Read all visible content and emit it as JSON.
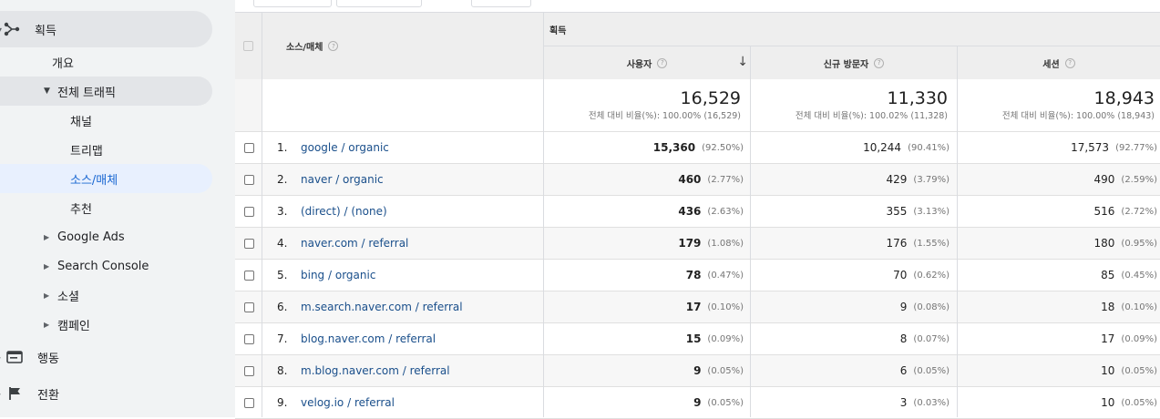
{
  "sidebar": {
    "sections": [
      {
        "label": "획득",
        "icon": "acquisition-icon"
      },
      {
        "label": "행동",
        "icon": "behavior-icon"
      },
      {
        "label": "전환",
        "icon": "flag-icon"
      }
    ],
    "items": [
      {
        "label": "개요"
      },
      {
        "label": "전체 트래픽"
      },
      {
        "label": "채널"
      },
      {
        "label": "트리맵"
      },
      {
        "label": "소스/매체"
      },
      {
        "label": "추천"
      },
      {
        "label": "Google Ads"
      },
      {
        "label": "Search Console"
      },
      {
        "label": "소셜"
      },
      {
        "label": "캠페인"
      }
    ],
    "colors": {
      "selected_bg": "#e8f0fe",
      "selected_text": "#1967d2",
      "group_bg": "#e3e5e8"
    }
  },
  "table": {
    "group_header": "획득",
    "dimension_header": "소스/매체",
    "help_glyph": "?",
    "sort_glyph": "↓",
    "columns": [
      {
        "label": "사용자"
      },
      {
        "label": "신규 방문자"
      },
      {
        "label": "세션"
      }
    ],
    "totals": [
      {
        "value": "16,529",
        "sub": "전체 대비 비율(%): 100.00% (16,529)"
      },
      {
        "value": "11,330",
        "sub": "전체 대비 비율(%): 100.02% (11,328)"
      },
      {
        "value": "18,943",
        "sub": "전체 대비 비율(%): 100.00% (18,943)"
      }
    ],
    "rows": [
      {
        "rank": "1.",
        "source": "google / organic",
        "users": "15,360",
        "users_pct": "(92.50%)",
        "new": "10,244",
        "new_pct": "(90.41%)",
        "sessions": "17,573",
        "sessions_pct": "(92.77%)"
      },
      {
        "rank": "2.",
        "source": "naver / organic",
        "users": "460",
        "users_pct": "(2.77%)",
        "new": "429",
        "new_pct": "(3.79%)",
        "sessions": "490",
        "sessions_pct": "(2.59%)"
      },
      {
        "rank": "3.",
        "source": "(direct) / (none)",
        "users": "436",
        "users_pct": "(2.63%)",
        "new": "355",
        "new_pct": "(3.13%)",
        "sessions": "516",
        "sessions_pct": "(2.72%)"
      },
      {
        "rank": "4.",
        "source": "naver.com / referral",
        "users": "179",
        "users_pct": "(1.08%)",
        "new": "176",
        "new_pct": "(1.55%)",
        "sessions": "180",
        "sessions_pct": "(0.95%)"
      },
      {
        "rank": "5.",
        "source": "bing / organic",
        "users": "78",
        "users_pct": "(0.47%)",
        "new": "70",
        "new_pct": "(0.62%)",
        "sessions": "85",
        "sessions_pct": "(0.45%)"
      },
      {
        "rank": "6.",
        "source": "m.search.naver.com / referral",
        "users": "17",
        "users_pct": "(0.10%)",
        "new": "9",
        "new_pct": "(0.08%)",
        "sessions": "18",
        "sessions_pct": "(0.10%)"
      },
      {
        "rank": "7.",
        "source": "blog.naver.com / referral",
        "users": "15",
        "users_pct": "(0.09%)",
        "new": "8",
        "new_pct": "(0.07%)",
        "sessions": "17",
        "sessions_pct": "(0.09%)"
      },
      {
        "rank": "8.",
        "source": "m.blog.naver.com / referral",
        "users": "9",
        "users_pct": "(0.05%)",
        "new": "6",
        "new_pct": "(0.05%)",
        "sessions": "10",
        "sessions_pct": "(0.05%)"
      },
      {
        "rank": "9.",
        "source": "velog.io / referral",
        "users": "9",
        "users_pct": "(0.05%)",
        "new": "3",
        "new_pct": "(0.03%)",
        "sessions": "10",
        "sessions_pct": "(0.05%)"
      }
    ]
  }
}
